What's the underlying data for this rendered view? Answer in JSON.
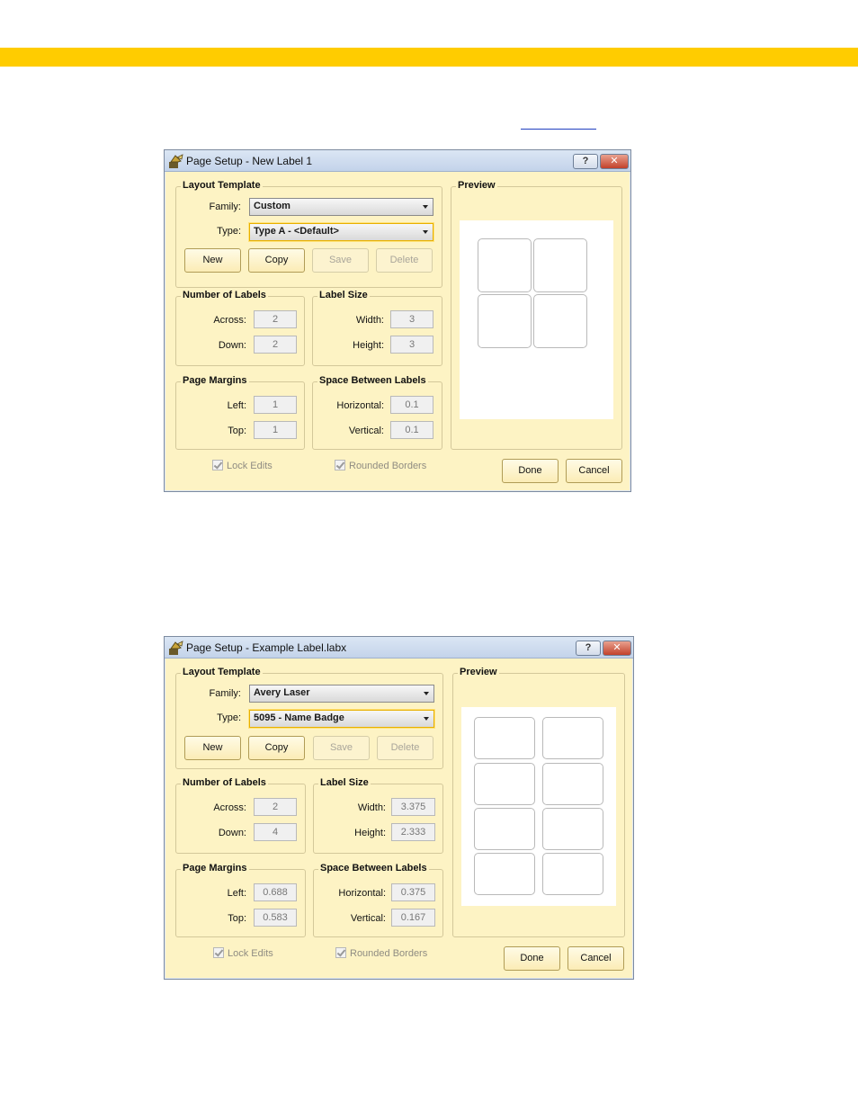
{
  "colors": {
    "top_band": "#ffcc00",
    "dialog_bg": "#fdf3c4",
    "close_button": "#c2412a"
  },
  "dialogs": [
    {
      "title": "Page Setup - New Label 1",
      "help_label": "?",
      "close_label": "✕",
      "layout_template": {
        "label": "Layout Template",
        "family_label": "Family:",
        "family_value": "Custom",
        "type_label": "Type:",
        "type_value": "Type A - <Default>",
        "buttons": {
          "new": "New",
          "copy": "Copy",
          "save": "Save",
          "delete": "Delete"
        }
      },
      "number_of_labels": {
        "label": "Number of Labels",
        "across_label": "Across:",
        "across_value": "2",
        "down_label": "Down:",
        "down_value": "2"
      },
      "label_size": {
        "label": "Label Size",
        "width_label": "Width:",
        "width_value": "3",
        "height_label": "Height:",
        "height_value": "3"
      },
      "page_margins": {
        "label": "Page Margins",
        "left_label": "Left:",
        "left_value": "1",
        "top_label": "Top:",
        "top_value": "1"
      },
      "space_between": {
        "label": "Space Between Labels",
        "horizontal_label": "Horizontal:",
        "horizontal_value": "0.1",
        "vertical_label": "Vertical:",
        "vertical_value": "0.1"
      },
      "preview_label": "Preview",
      "lock_edits": {
        "label": "Lock Edits",
        "checked": true
      },
      "rounded_borders": {
        "label": "Rounded Borders",
        "checked": true
      },
      "done_label": "Done",
      "cancel_label": "Cancel"
    },
    {
      "title": "Page Setup - Example Label.labx",
      "help_label": "?",
      "close_label": "✕",
      "layout_template": {
        "label": "Layout Template",
        "family_label": "Family:",
        "family_value": "Avery Laser",
        "type_label": "Type:",
        "type_value": "5095 - Name Badge",
        "buttons": {
          "new": "New",
          "copy": "Copy",
          "save": "Save",
          "delete": "Delete"
        }
      },
      "number_of_labels": {
        "label": "Number of Labels",
        "across_label": "Across:",
        "across_value": "2",
        "down_label": "Down:",
        "down_value": "4"
      },
      "label_size": {
        "label": "Label Size",
        "width_label": "Width:",
        "width_value": "3.375",
        "height_label": "Height:",
        "height_value": "2.333"
      },
      "page_margins": {
        "label": "Page Margins",
        "left_label": "Left:",
        "left_value": "0.688",
        "top_label": "Top:",
        "top_value": "0.583"
      },
      "space_between": {
        "label": "Space Between Labels",
        "horizontal_label": "Horizontal:",
        "horizontal_value": "0.375",
        "vertical_label": "Vertical:",
        "vertical_value": "0.167"
      },
      "preview_label": "Preview",
      "lock_edits": {
        "label": "Lock Edits",
        "checked": true
      },
      "rounded_borders": {
        "label": "Rounded Borders",
        "checked": true
      },
      "done_label": "Done",
      "cancel_label": "Cancel"
    }
  ]
}
